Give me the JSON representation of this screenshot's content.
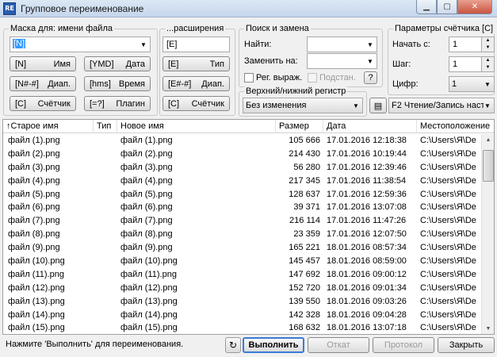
{
  "window": {
    "title": "Групповое переименование",
    "icon": "RE"
  },
  "mask": {
    "group_title": "Маска для: имени файла",
    "name_value": "[N]",
    "ext_group_title": "...расширения",
    "ext_value": "[E]",
    "buttons": [
      {
        "code": "[N]",
        "label": "Имя"
      },
      {
        "code": "[YMD]",
        "label": "Дата"
      },
      {
        "code": "[N#-#]",
        "label": "Диап."
      },
      {
        "code": "[hms]",
        "label": "Время"
      },
      {
        "code": "[C]",
        "label": "Счётчик"
      },
      {
        "code": "[=?]",
        "label": "Плагин"
      }
    ],
    "ext_buttons": [
      {
        "code": "[E]",
        "label": "Тип"
      },
      {
        "code": "[E#-#]",
        "label": "Диап."
      },
      {
        "code": "[C]",
        "label": "Счётчик"
      }
    ]
  },
  "search": {
    "group_title": "Поиск и замена",
    "find_label": "Найти:",
    "replace_label": "Заменить на:",
    "regex_label": "Рег. выраж.",
    "subst_label": "Подстан.",
    "help_label": "?"
  },
  "case": {
    "group_title": "Верхний/нижний регистр",
    "value": "Без изменения"
  },
  "counter": {
    "group_title": "Параметры счётчика [C]",
    "start_label": "Начать с:",
    "start_value": "1",
    "step_label": "Шаг:",
    "step_value": "1",
    "digits_label": "Цифр:",
    "digits_value": "1"
  },
  "plugin_combo": {
    "value": "F2 Чтение/Запись наст"
  },
  "table": {
    "columns": [
      "↑Старое имя",
      "Тип",
      "Новое имя",
      "Размер",
      "Дата",
      "Местоположение"
    ],
    "rows": [
      {
        "old": "файл (1).png",
        "type": "",
        "new": "файл (1).png",
        "size": "105 666",
        "date": "17.01.2016 12:18:38",
        "loc": "C:\\Users\\Я\\De"
      },
      {
        "old": "файл (2).png",
        "type": "",
        "new": "файл (2).png",
        "size": "214 430",
        "date": "17.01.2016 10:19:44",
        "loc": "C:\\Users\\Я\\De"
      },
      {
        "old": "файл (3).png",
        "type": "",
        "new": "файл (3).png",
        "size": "56 280",
        "date": "17.01.2016 12:39:46",
        "loc": "C:\\Users\\Я\\De"
      },
      {
        "old": "файл (4).png",
        "type": "",
        "new": "файл (4).png",
        "size": "217 345",
        "date": "17.01.2016 11:38:54",
        "loc": "C:\\Users\\Я\\De"
      },
      {
        "old": "файл (5).png",
        "type": "",
        "new": "файл (5).png",
        "size": "128 637",
        "date": "17.01.2016 12:59:36",
        "loc": "C:\\Users\\Я\\De"
      },
      {
        "old": "файл (6).png",
        "type": "",
        "new": "файл (6).png",
        "size": "39 371",
        "date": "17.01.2016 13:07:08",
        "loc": "C:\\Users\\Я\\De"
      },
      {
        "old": "файл (7).png",
        "type": "",
        "new": "файл (7).png",
        "size": "216 114",
        "date": "17.01.2016 11:47:26",
        "loc": "C:\\Users\\Я\\De"
      },
      {
        "old": "файл (8).png",
        "type": "",
        "new": "файл (8).png",
        "size": "23 359",
        "date": "17.01.2016 12:07:50",
        "loc": "C:\\Users\\Я\\De"
      },
      {
        "old": "файл (9).png",
        "type": "",
        "new": "файл (9).png",
        "size": "165 221",
        "date": "18.01.2016 08:57:34",
        "loc": "C:\\Users\\Я\\De"
      },
      {
        "old": "файл (10).png",
        "type": "",
        "new": "файл (10).png",
        "size": "145 457",
        "date": "18.01.2016 08:59:00",
        "loc": "C:\\Users\\Я\\De"
      },
      {
        "old": "файл (11).png",
        "type": "",
        "new": "файл (11).png",
        "size": "147 692",
        "date": "18.01.2016 09:00:12",
        "loc": "C:\\Users\\Я\\De"
      },
      {
        "old": "файл (12).png",
        "type": "",
        "new": "файл (12).png",
        "size": "152 720",
        "date": "18.01.2016 09:01:34",
        "loc": "C:\\Users\\Я\\De"
      },
      {
        "old": "файл (13).png",
        "type": "",
        "new": "файл (13).png",
        "size": "139 550",
        "date": "18.01.2016 09:03:26",
        "loc": "C:\\Users\\Я\\De"
      },
      {
        "old": "файл (14).png",
        "type": "",
        "new": "файл (14).png",
        "size": "142 328",
        "date": "18.01.2016 09:04:28",
        "loc": "C:\\Users\\Я\\De"
      },
      {
        "old": "файл (15).png",
        "type": "",
        "new": "файл (15).png",
        "size": "168 632",
        "date": "18.01.2016 13:07:18",
        "loc": "C:\\Users\\Я\\De"
      }
    ]
  },
  "footer": {
    "status": "Нажмите 'Выполнить' для переименования.",
    "run_label": "Выполнить",
    "undo_label": "Откат",
    "log_label": "Протокол",
    "close_label": "Закрыть"
  }
}
